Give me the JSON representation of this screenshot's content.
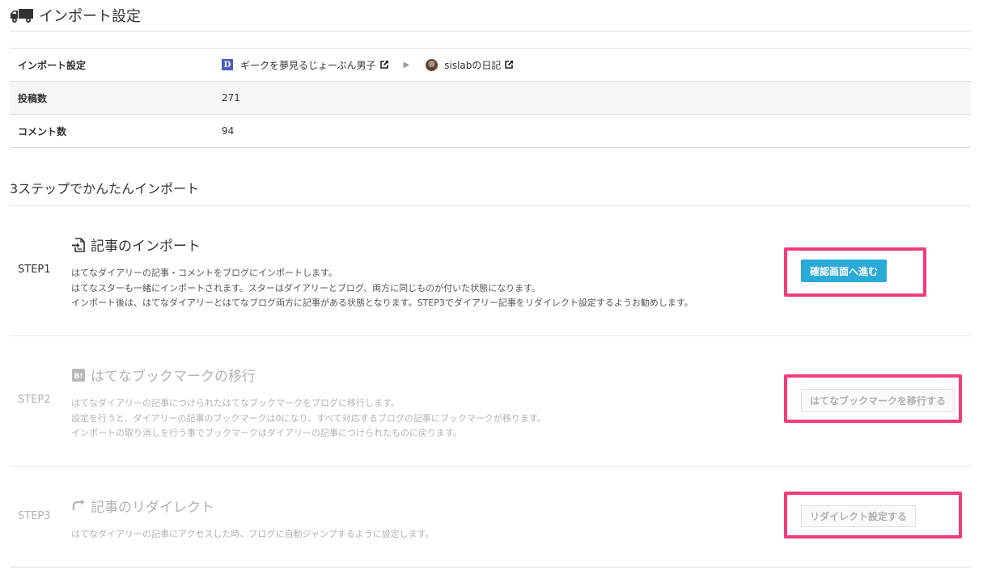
{
  "header": {
    "title": "インポート設定",
    "icon": "truck-icon"
  },
  "info_table": {
    "rows": [
      {
        "label": "インポート設定",
        "source_blog": "ギークを夢見るじょーぶん男子",
        "source_badge": "D",
        "dest_blog": "sislabの日記"
      },
      {
        "label": "投稿数",
        "value": "271"
      },
      {
        "label": "コメント数",
        "value": "94"
      }
    ]
  },
  "steps_title": "3ステップでかんたんインポート",
  "steps": [
    {
      "label": "STEP1",
      "title": "記事のインポート",
      "icon": "import-document-icon",
      "desc": [
        "はてなダイアリーの記事・コメントをブログにインポートします。",
        "はてなスターも一緒にインポートされます。スターはダイアリーとブログ、両方に同じものが付いた状態になります。",
        "インポート後は、はてなダイアリーとはてなブログ両方に記事がある状態となります。STEP3でダイアリー記事をリダイレクト設定するようお勧めします。"
      ],
      "button": "確認画面へ進む",
      "enabled": true
    },
    {
      "label": "STEP2",
      "title": "はてなブックマークの移行",
      "icon": "hatena-bookmark-icon",
      "icon_text": "B!",
      "desc": [
        "はてなダイアリーの記事につけられたはてなブックマークをブログに移行します。",
        "設定を行うと、ダイアリーの記事のブックマークは0になり、すべて対応するブログの記事にブックマークが移ります。",
        "インポートの取り消しを行う事でブックマークはダイアリーの記事につけられたものに戻ります。"
      ],
      "button": "はてなブックマークを移行する",
      "enabled": false
    },
    {
      "label": "STEP3",
      "title": "記事のリダイレクト",
      "icon": "redirect-icon",
      "desc": [
        "はてなダイアリーの記事にアクセスした時、ブログに自動ジャンプするように設定します。"
      ],
      "button": "リダイレクト設定する",
      "enabled": false
    }
  ],
  "colors": {
    "highlight": "#f23d7a",
    "primary_button": "#2aaad8",
    "diary_badge": "#4a5fbf"
  }
}
